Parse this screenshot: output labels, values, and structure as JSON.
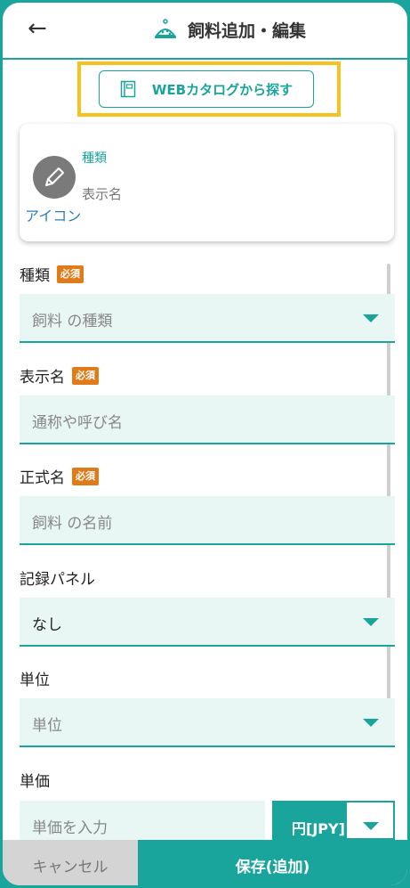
{
  "header": {
    "title": "飼料追加・編集",
    "back_icon": "back-arrow-icon",
    "title_icon": "feed-bowl-icon"
  },
  "web_catalog_button": {
    "label": "WEBカタログから探す",
    "icon": "book-icon"
  },
  "card": {
    "type_label": "種類",
    "name_label": "表示名",
    "icon_label": "アイコン",
    "icon": "pencil-icon"
  },
  "fields": {
    "type": {
      "label": "種類",
      "required_badge": "必須",
      "placeholder": "飼料 の種類"
    },
    "display_name": {
      "label": "表示名",
      "required_badge": "必須",
      "placeholder": "通称や呼び名"
    },
    "official_name": {
      "label": "正式名",
      "required_badge": "必須",
      "placeholder": "飼料 の名前"
    },
    "record_panel": {
      "label": "記録パネル",
      "value": "なし"
    },
    "unit": {
      "label": "単位",
      "placeholder": "単位"
    },
    "unit_price": {
      "label": "単価",
      "placeholder": "単価を入力",
      "currency": "円[JPY]"
    }
  },
  "footer": {
    "cancel_label": "キャンセル",
    "save_label": "保存(追加)"
  },
  "colors": {
    "accent": "#1aa59c",
    "required_badge": "#e07b1a",
    "highlight": "#f7c21b",
    "link": "#2c7fbe"
  }
}
